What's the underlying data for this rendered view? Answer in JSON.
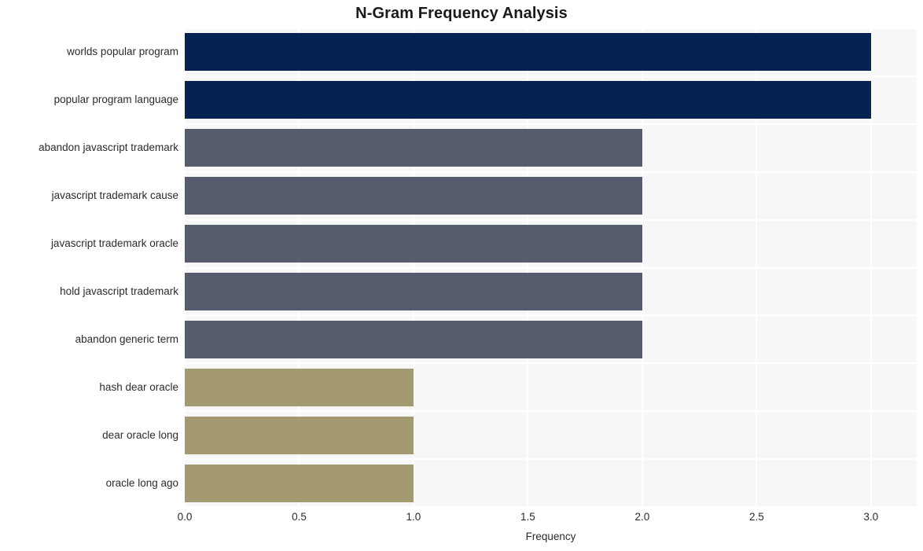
{
  "chart_data": {
    "type": "bar",
    "orientation": "horizontal",
    "title": "N-Gram Frequency Analysis",
    "xlabel": "Frequency",
    "ylabel": "",
    "xlim": [
      0.0,
      3.2
    ],
    "xticks": [
      "0.0",
      "0.5",
      "1.0",
      "1.5",
      "2.0",
      "2.5",
      "3.0"
    ],
    "xtick_values": [
      0.0,
      0.5,
      1.0,
      1.5,
      2.0,
      2.5,
      3.0
    ],
    "grid": true,
    "legend": "none",
    "categories": [
      "worlds popular program",
      "popular program language",
      "abandon javascript trademark",
      "javascript trademark cause",
      "javascript trademark oracle",
      "hold javascript trademark",
      "abandon generic term",
      "hash dear oracle",
      "dear oracle long",
      "oracle long ago"
    ],
    "values": [
      3,
      3,
      2,
      2,
      2,
      2,
      2,
      1,
      1,
      1
    ],
    "bar_colors": [
      "#042352",
      "#042352",
      "#565c6e",
      "#565c6e",
      "#565c6e",
      "#565c6e",
      "#565c6e",
      "#a39a71",
      "#a39a71",
      "#a39a71"
    ],
    "plot_background": "#f7f7f7",
    "gridline_color": "#ffffff",
    "figure_background": "#ffffff",
    "text_color": "#2b2b2b"
  }
}
